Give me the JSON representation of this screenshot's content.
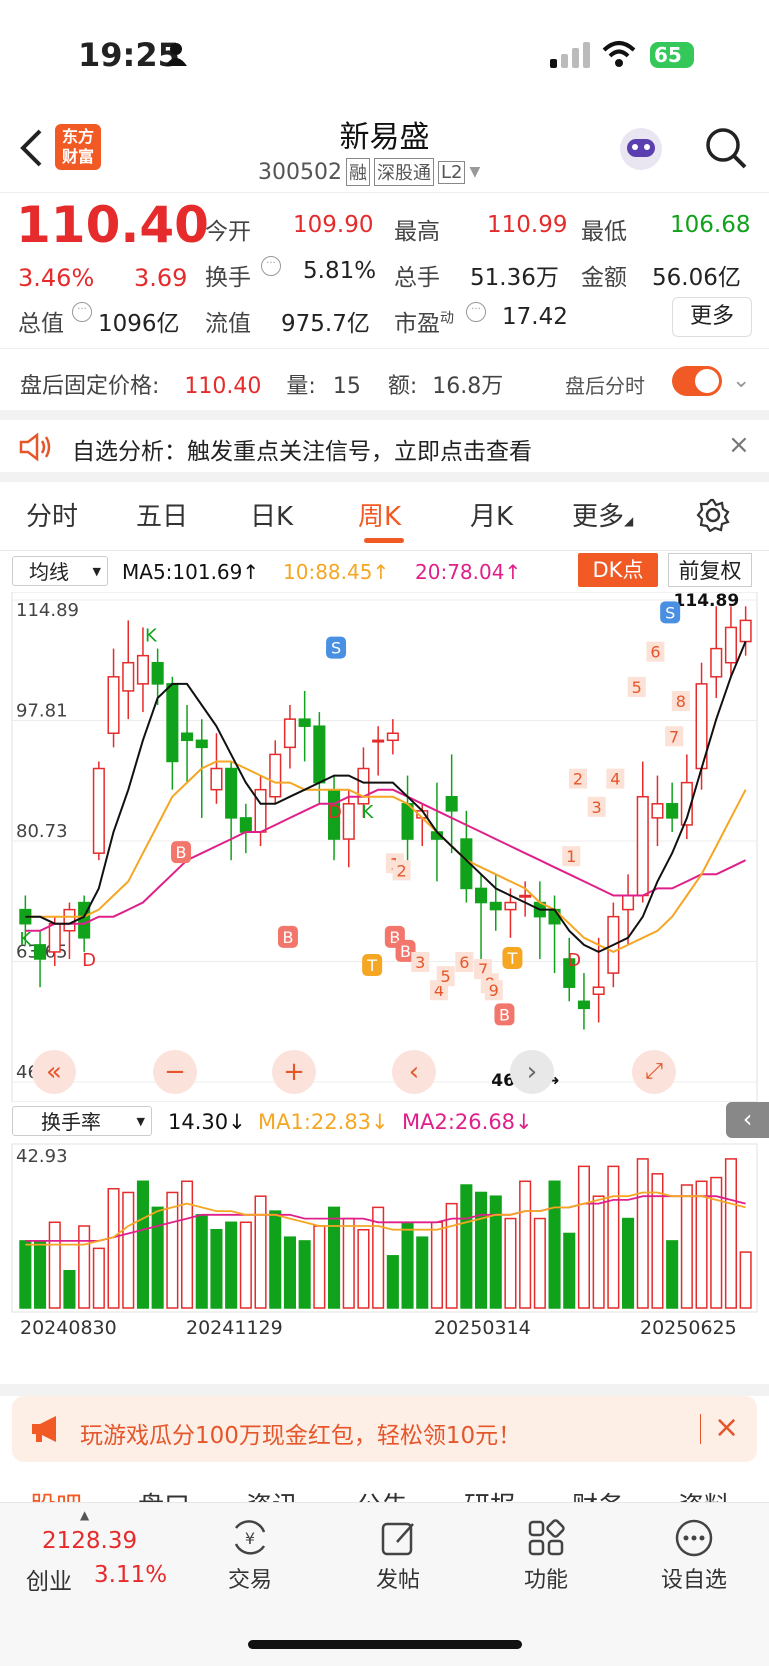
{
  "status_bar": {
    "time": "19:25",
    "battery": "65"
  },
  "header": {
    "title": "新易盛",
    "code": "300502",
    "badges": [
      "融",
      "深股通",
      "L2"
    ],
    "logo_line1": "东方",
    "logo_line2": "财富"
  },
  "quote": {
    "price": "110.40",
    "change_pct": "3.46%",
    "change": "3.69",
    "open_label": "今开",
    "open": "109.90",
    "high_label": "最高",
    "high": "110.99",
    "low_label": "最低",
    "low": "106.68",
    "turnover_label": "换手",
    "turnover": "5.81%",
    "volume_label": "总手",
    "volume": "51.36万",
    "amount_label": "金额",
    "amount": "56.06亿",
    "mktcap_label": "总值",
    "mktcap": "1096亿",
    "float_label": "流值",
    "float": "975.7亿",
    "pe_label": "市盈",
    "pe_sup": "动",
    "pe": "17.42",
    "more_button": "更多"
  },
  "after_hours": {
    "label": "盘后固定价格:",
    "price": "110.40",
    "vol_label": "量:",
    "vol": "15",
    "amt_label": "额:",
    "amt": "16.8万",
    "toggle_label": "盘后分时"
  },
  "alert": {
    "text": "自选分析：触发重点关注信号，立即点击查看"
  },
  "tabs": [
    "分时",
    "五日",
    "日K",
    "周K",
    "月K",
    "更多"
  ],
  "active_tab": "周K",
  "ma_bar": {
    "select": "均线",
    "ma5": "MA5:101.69↑",
    "ma10": "10:88.45↑",
    "ma20": "20:78.04↑",
    "dk_button": "DK点",
    "adjust_button": "前复权"
  },
  "chart_data": {
    "type": "candlestick",
    "y_ticks": [
      "114.89",
      "97.81",
      "80.73",
      "63.65",
      "46.56"
    ],
    "max_label": "114.89",
    "min_label": "46.56→",
    "ylim": [
      46.56,
      114.89
    ],
    "candles": [
      [
        71,
        69,
        73,
        66
      ],
      [
        66,
        64,
        68,
        60
      ],
      [
        65,
        69,
        70,
        63
      ],
      [
        68,
        71,
        72,
        64
      ],
      [
        72,
        67,
        73,
        65
      ],
      [
        79,
        91,
        92,
        78
      ],
      [
        96,
        104,
        108,
        94
      ],
      [
        102,
        106,
        112,
        98
      ],
      [
        103,
        107,
        111,
        99
      ],
      [
        106,
        103,
        108,
        100
      ],
      [
        103,
        92,
        104,
        88
      ],
      [
        96,
        95,
        100,
        89
      ],
      [
        95,
        94,
        98,
        84
      ],
      [
        88,
        91,
        96,
        86
      ],
      [
        91,
        84,
        92,
        78
      ],
      [
        84,
        82,
        86,
        79
      ],
      [
        82,
        88,
        90,
        80
      ],
      [
        87,
        93,
        95,
        86
      ],
      [
        94,
        98,
        100,
        91
      ],
      [
        98,
        97,
        102,
        92
      ],
      [
        97,
        89,
        99,
        86
      ],
      [
        88,
        81,
        90,
        78
      ],
      [
        81,
        86,
        88,
        77
      ],
      [
        86,
        91,
        94,
        84
      ],
      [
        95,
        95,
        97,
        90
      ],
      [
        95,
        96,
        98,
        93
      ],
      [
        86,
        81,
        90,
        78
      ],
      [
        84,
        85,
        86,
        80
      ],
      [
        82,
        81,
        89,
        75
      ],
      [
        87,
        85,
        93,
        79
      ],
      [
        81,
        74,
        85,
        72
      ],
      [
        74,
        72,
        76,
        64
      ],
      [
        72,
        71,
        76,
        68
      ],
      [
        71,
        72,
        74,
        67
      ],
      [
        73,
        73,
        75,
        70
      ],
      [
        72,
        70,
        75,
        64
      ],
      [
        71,
        69,
        73,
        62
      ],
      [
        64,
        60,
        67,
        58
      ],
      [
        58,
        57,
        62,
        54
      ],
      [
        59,
        60,
        67,
        55
      ],
      [
        62,
        70,
        72,
        60
      ],
      [
        71,
        73,
        76,
        66
      ],
      [
        73,
        87,
        92,
        72
      ],
      [
        84,
        86,
        90,
        80
      ],
      [
        86,
        84,
        89,
        82
      ],
      [
        83,
        89,
        93,
        81
      ],
      [
        91,
        103,
        106,
        88
      ],
      [
        104,
        108,
        114,
        101
      ],
      [
        106,
        111,
        114,
        104
      ],
      [
        109,
        112,
        114,
        107
      ]
    ],
    "ma5": [
      70,
      70,
      69,
      69,
      70,
      74,
      82,
      88,
      95,
      101,
      103,
      103,
      100,
      97,
      93,
      89,
      86,
      86,
      87,
      88,
      89,
      90,
      90,
      89,
      89,
      89,
      87,
      85,
      82,
      80,
      78,
      76,
      74,
      73,
      72,
      71,
      71,
      68,
      66,
      65,
      66,
      67,
      70,
      75,
      79,
      84,
      91,
      98,
      104,
      109
    ],
    "ma10": [
      70,
      70,
      70,
      70,
      70,
      71,
      73,
      75,
      79,
      83,
      87,
      89,
      91,
      92,
      92,
      91,
      90,
      89,
      89,
      88,
      88,
      88,
      88,
      87,
      87,
      87,
      86,
      84,
      82,
      80,
      78,
      77,
      76,
      75,
      74,
      72,
      71,
      69,
      67,
      66,
      65,
      66,
      67,
      68,
      70,
      73,
      76,
      80,
      84,
      88
    ],
    "ma20": [
      68,
      68,
      69,
      69,
      69,
      70,
      70,
      71,
      72,
      74,
      76,
      78,
      79,
      80,
      81,
      82,
      82,
      83,
      84,
      85,
      86,
      86,
      87,
      87,
      88,
      88,
      87,
      86,
      85,
      84,
      83,
      82,
      81,
      80,
      79,
      78,
      77,
      76,
      75,
      74,
      73,
      73,
      73,
      74,
      74,
      75,
      76,
      76,
      77,
      78
    ],
    "markers": [
      "K",
      "D",
      "K",
      "B",
      "B",
      "S",
      "D",
      "K",
      "B",
      "T",
      "B",
      "1",
      "2",
      "3",
      "4",
      "5",
      "6",
      "7",
      "8",
      "9",
      "T",
      "B",
      "D",
      "1",
      "2",
      "3",
      "4",
      "5",
      "6",
      "7",
      "8",
      "S"
    ]
  },
  "controls": {
    "icons": [
      "fast-rewind-icon",
      "zoom-out-icon",
      "zoom-in-icon",
      "prev-icon",
      "next-icon",
      "fullscreen-icon"
    ]
  },
  "turnover_bar": {
    "select": "换手率",
    "value": "14.30↓",
    "ma1": "MA1:22.83↓",
    "ma2": "MA2:26.68↓",
    "max_label": "42.93"
  },
  "volume_data": {
    "values": [
      18,
      18,
      23,
      10,
      22,
      16,
      32,
      31,
      34,
      27,
      31,
      34,
      25,
      21,
      23,
      23,
      30,
      26,
      19,
      18,
      22,
      27,
      24,
      21,
      27,
      14,
      23,
      19,
      23,
      28,
      33,
      31,
      30,
      24,
      34,
      24,
      34,
      20,
      38,
      30,
      38,
      24,
      40,
      36,
      18,
      33,
      34,
      35,
      40,
      15
    ],
    "up": [
      false,
      false,
      true,
      false,
      true,
      true,
      true,
      true,
      false,
      false,
      true,
      true,
      false,
      false,
      false,
      true,
      true,
      false,
      false,
      false,
      true,
      false,
      true,
      true,
      true,
      false,
      false,
      false,
      true,
      true,
      false,
      false,
      false,
      true,
      true,
      true,
      false,
      false,
      true,
      true,
      true,
      false,
      true,
      true,
      false,
      true,
      true,
      true,
      true,
      true
    ],
    "ma1": [
      17,
      17,
      17,
      17,
      17,
      18,
      19,
      22,
      24,
      26,
      27,
      28,
      27,
      26,
      26,
      25,
      25,
      25,
      24,
      23,
      22,
      22,
      22,
      22,
      22,
      21,
      21,
      21,
      21,
      22,
      23,
      24,
      25,
      25,
      26,
      26,
      27,
      27,
      28,
      29,
      30,
      30,
      31,
      31,
      30,
      30,
      30,
      29,
      28,
      27
    ],
    "ma2": [
      18,
      18,
      18,
      18,
      18,
      18,
      19,
      20,
      21,
      22,
      23,
      24,
      25,
      25,
      25,
      25,
      25,
      25,
      25,
      24,
      24,
      24,
      24,
      24,
      23,
      23,
      23,
      23,
      23,
      24,
      24,
      25,
      25,
      25,
      26,
      26,
      27,
      27,
      28,
      28,
      29,
      29,
      30,
      30,
      30,
      30,
      30,
      30,
      29,
      28
    ],
    "dates": [
      "20240830",
      "20241129",
      "20250314",
      "20250625"
    ]
  },
  "promo": {
    "text": "玩游戏瓜分100万现金红包，轻松领10元！"
  },
  "subtabs_partial": [
    "股吧",
    "盘口",
    "资讯",
    "公告",
    "研报",
    "财务",
    "资料"
  ],
  "bottom": {
    "index_value": "2128.39",
    "index_name": "创业",
    "index_pct": "3.11%",
    "items": [
      "交易",
      "发帖",
      "功能",
      "设自选"
    ]
  }
}
